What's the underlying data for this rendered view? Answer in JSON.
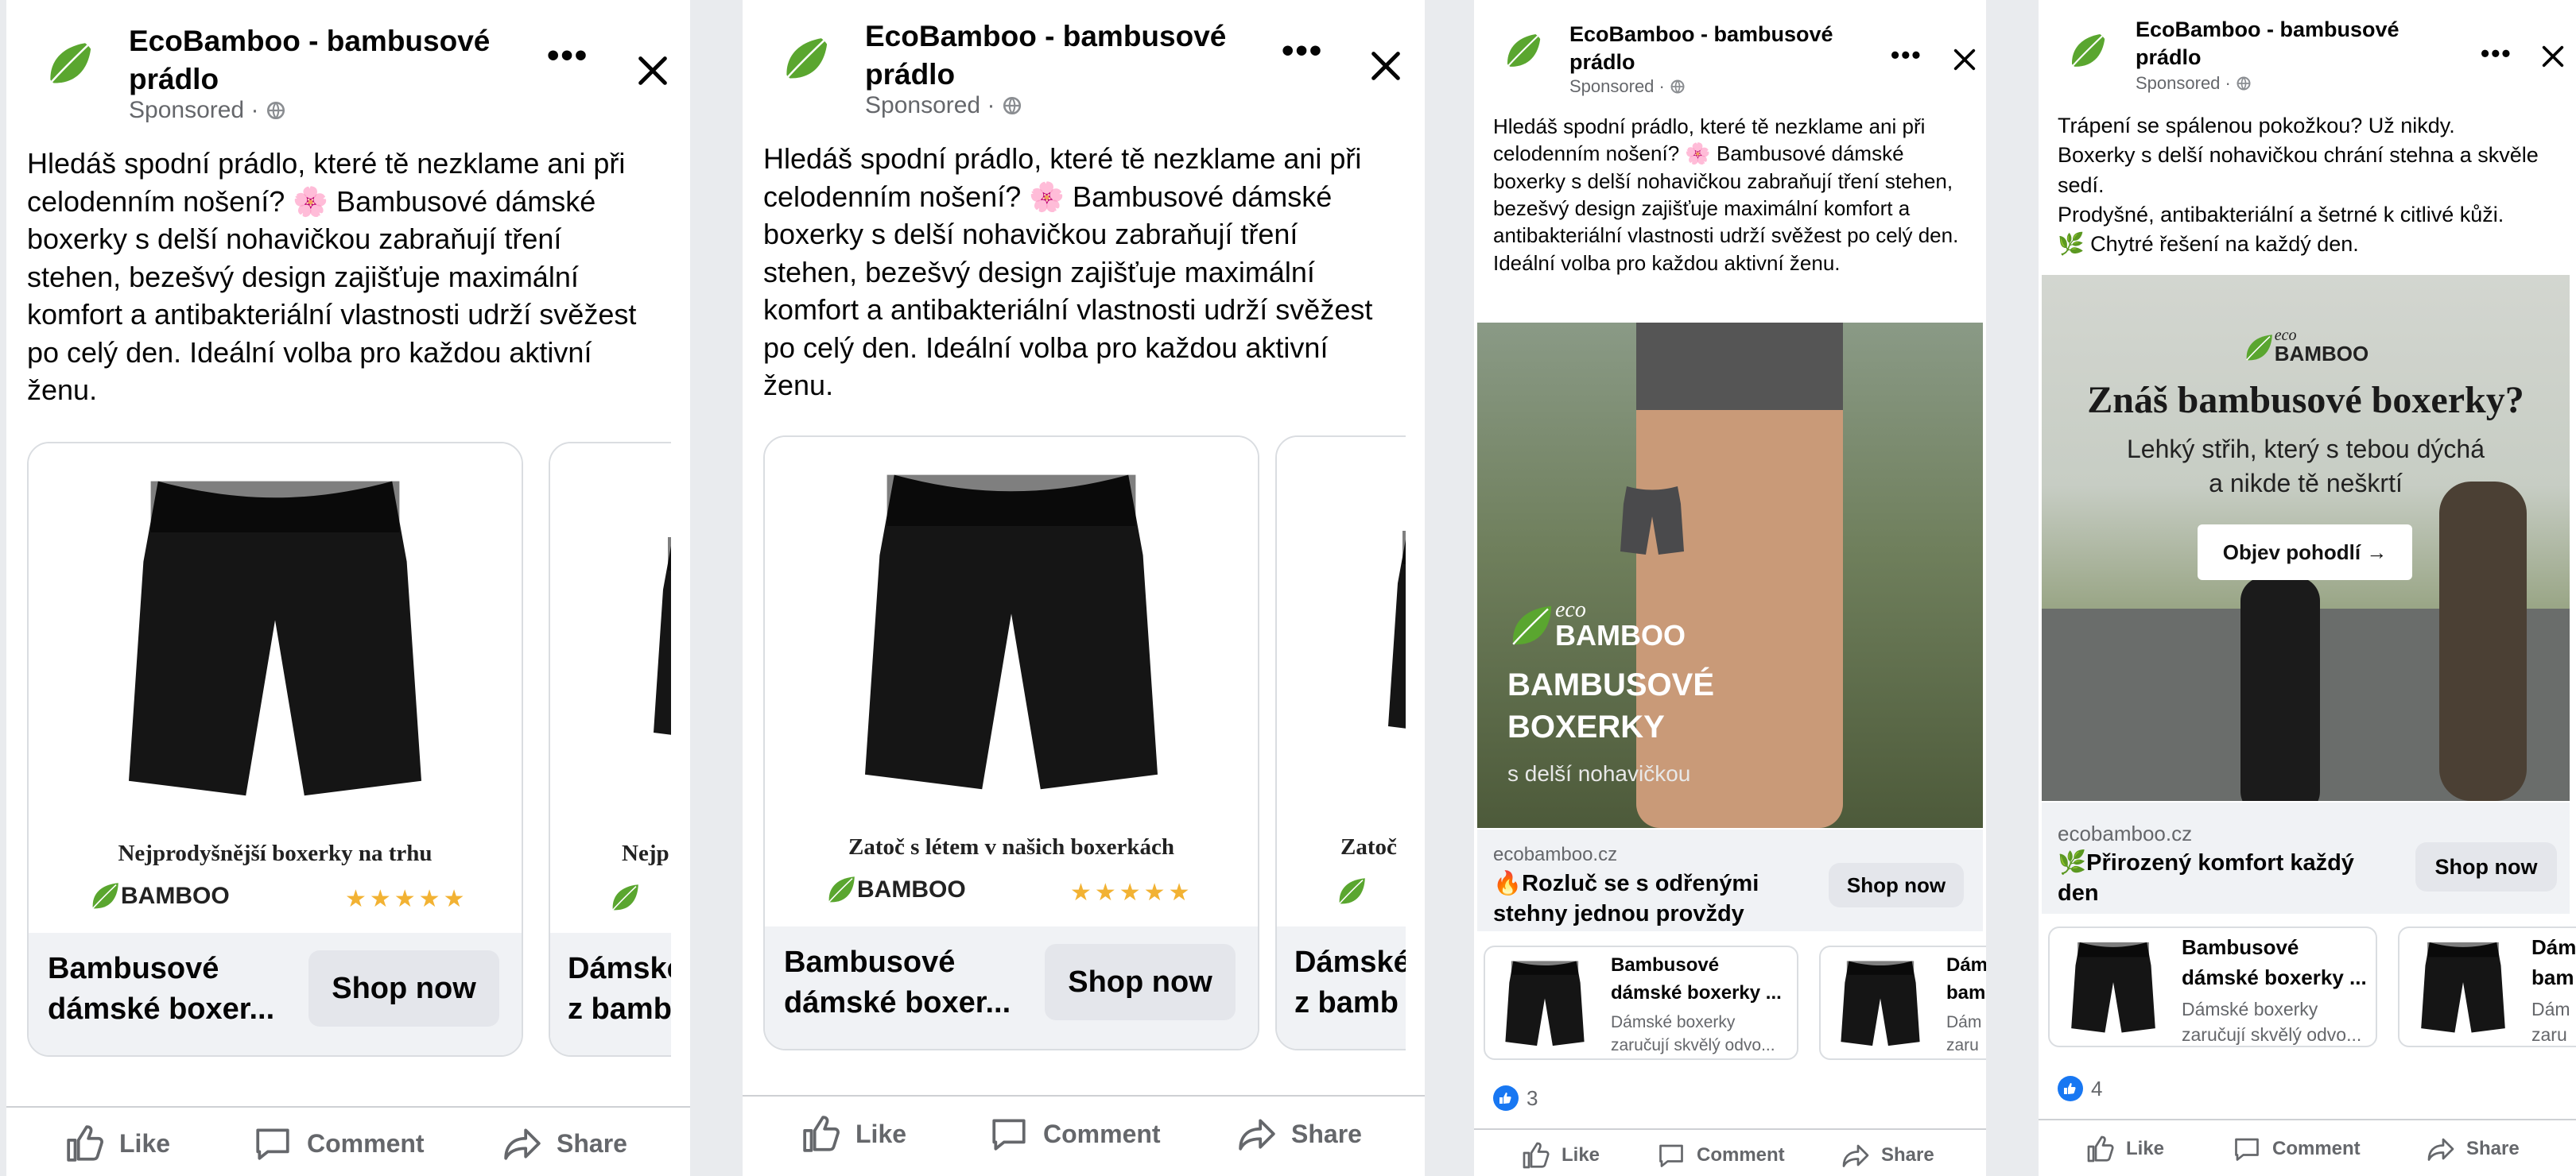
{
  "post": {
    "brand": "EcoBamboo - bambusové prádlo",
    "brand_line1": "EcoBamboo - bambusové",
    "brand_line2": "prádlo",
    "sponsored": "Sponsored · ",
    "body_long": "Hledáš spodní prádlo, které tě nezklame ani při celodenním nošení? 🌸 Bambusové dámské boxerky s delší nohavičkou zabraňují tření stehen, bezešvý design zajišťuje maximální komfort a antibakteriální vlastnosti udrží svěžest po celý den. Ideální volba pro každou aktivní ženu.",
    "body_short": "Trápení se spálenou pokožkou? Už nikdy.\nBoxerky s delší nohavičkou chrání stehna a skvěle sedí.\nProdyšné, antibakteriální a šetrné k citlivé kůži.\n🌿 Chytré řešení na každý den."
  },
  "panels": [
    {
      "card1_caption": "Nejprodyšnější boxerky na trhu",
      "card2_caption": "Nejp",
      "card1_title": "Bambusové\ndámské boxer...",
      "card2_title": "Dámské\nz bamb",
      "shop_now": "Shop now"
    },
    {
      "card1_caption": "Zatoč s létem v našich boxerkách",
      "card2_caption": "Zatoč",
      "card1_title": "Bambusové\ndámské boxer...",
      "card2_title": "Dámské\nz bamb",
      "shop_now": "Shop now"
    },
    {
      "image_brand": "BAMBOO",
      "image_brand_eco": "eco",
      "image_headline_1": "BAMBUSOVÉ",
      "image_headline_2": "BOXERKY",
      "image_sub": "s delší nohavičkou",
      "domain": "ecobamboo.cz",
      "link_title": "🔥Rozluč se s odřenými\nstehny jednou provždy",
      "shop_now": "Shop now",
      "prod1_title": "Bambusové",
      "prod1_title2": "dámské boxerky ...",
      "prod1_desc": "Dámské boxerky",
      "prod1_desc2": "zaručují skvělý odvo...",
      "prod2_title": "Dám",
      "prod2_title2": "bam",
      "prod2_desc": "Dám",
      "prod2_desc2": "zaru",
      "likes": "3"
    },
    {
      "image_brand": "BAMBOO",
      "image_brand_eco": "eco",
      "image_headline": "Znáš bambusové boxerky?",
      "image_sub_1": "Lehký střih, který s tebou dýchá",
      "image_sub_2": "a nikde tě neškrtí",
      "image_cta": "Objev pohodlí →",
      "domain": "ecobamboo.cz",
      "link_title": "🌿Přirozený komfort každý\nden",
      "shop_now": "Shop now",
      "prod1_title": "Bambusové",
      "prod1_title2": "dámské boxerky ...",
      "prod1_desc": "Dámské boxerky",
      "prod1_desc2": "zaručují skvělý odvo...",
      "prod2_title": "Dám",
      "prod2_title2": "bam",
      "prod2_desc": "Dám",
      "prod2_desc2": "zaru",
      "likes": "4"
    }
  ],
  "actions": {
    "like": "Like",
    "comment": "Comment",
    "share": "Share"
  },
  "card_brand": {
    "eco": "eco",
    "bamboo": "BAMBOO"
  },
  "stars": "★★★★★",
  "icons": [
    "leaf-logo-icon",
    "globe-icon",
    "more-options-icon",
    "close-icon",
    "like-icon",
    "comment-icon",
    "share-icon",
    "chevron-right-icon",
    "thumbs-up-badge-icon"
  ],
  "colors": {
    "brand_green": "#5aa62f",
    "facebook_blue": "#1877f2",
    "star_gold": "#f2b233",
    "secondary_text": "#65676b"
  }
}
